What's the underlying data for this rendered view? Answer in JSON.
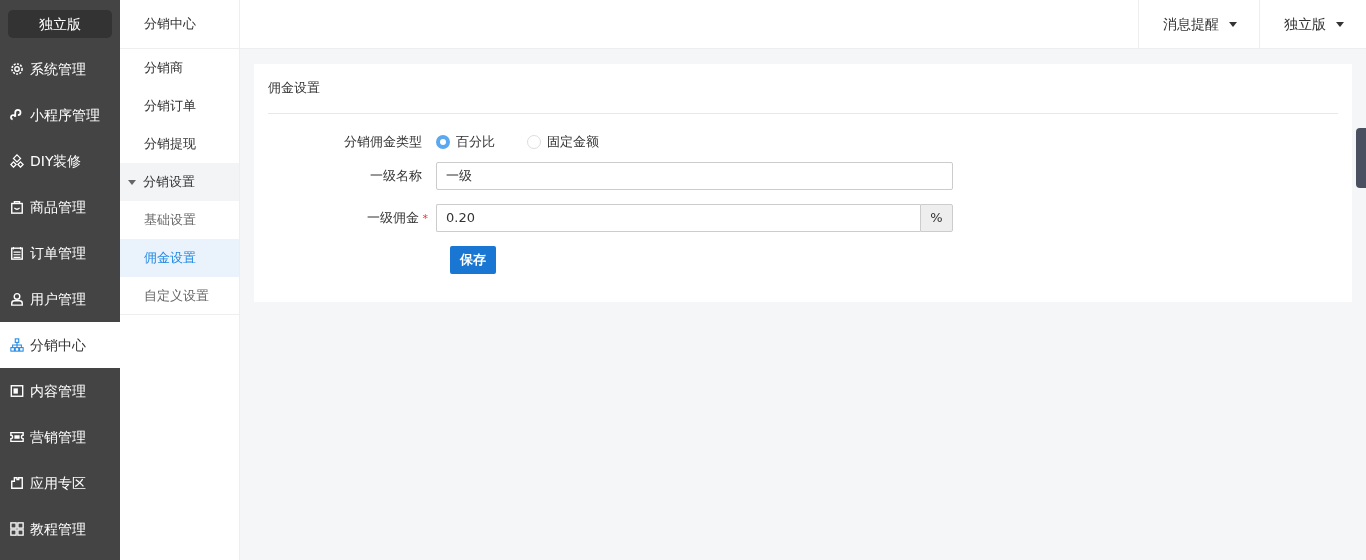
{
  "brand": "独立版",
  "sidebar": {
    "items": [
      {
        "label": "系统管理",
        "selected": false
      },
      {
        "label": "小程序管理",
        "selected": false
      },
      {
        "label": "DIY装修",
        "selected": false
      },
      {
        "label": "商品管理",
        "selected": false
      },
      {
        "label": "订单管理",
        "selected": false
      },
      {
        "label": "用户管理",
        "selected": false
      },
      {
        "label": "分销中心",
        "selected": true
      },
      {
        "label": "内容管理",
        "selected": false
      },
      {
        "label": "营销管理",
        "selected": false
      },
      {
        "label": "应用专区",
        "selected": false
      },
      {
        "label": "教程管理",
        "selected": false
      }
    ]
  },
  "submenu": {
    "title": "分销中心",
    "items": [
      {
        "label": "分销商",
        "kind": "link",
        "selected": false
      },
      {
        "label": "分销订单",
        "kind": "link",
        "selected": false
      },
      {
        "label": "分销提现",
        "kind": "link",
        "selected": false
      },
      {
        "label": "分销设置",
        "kind": "group",
        "expanded": true,
        "selected": false,
        "children": [
          {
            "label": "基础设置",
            "kind": "link",
            "selected": false
          },
          {
            "label": "佣金设置",
            "kind": "link",
            "selected": true
          },
          {
            "label": "自定义设置",
            "kind": "link",
            "selected": false
          }
        ]
      }
    ]
  },
  "topbar": {
    "menus": [
      "消息提醒",
      "独立版"
    ]
  },
  "panel": {
    "title": "佣金设置",
    "fields": [
      {
        "kind": "radio",
        "label": "分销佣金类型",
        "options": [
          {
            "label": "百分比",
            "selected": true
          },
          {
            "label": "固定金额",
            "selected": false
          }
        ]
      },
      {
        "kind": "text",
        "label": "一级名称",
        "value": "一级"
      },
      {
        "kind": "addon",
        "label": "一级佣金",
        "required_mark": "*",
        "value": "0.20",
        "addon": "%"
      }
    ],
    "button": "保存"
  }
}
